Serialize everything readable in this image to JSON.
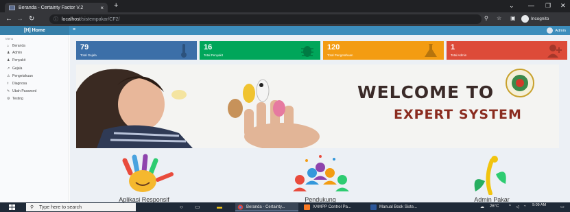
{
  "browser": {
    "tab_title": "Beranda - Certainty Factor V.2",
    "tab_close": "×",
    "new_tab": "+",
    "url_host": "localhost",
    "url_path": "/sistempakar/CF2/",
    "profile_label": "Incognito"
  },
  "app": {
    "brand": "[H] Home",
    "user_label": "Admin"
  },
  "sidebar": {
    "heading": "Menu",
    "items": [
      {
        "icon": "home-icon",
        "glyph": "⌂",
        "label": "Beranda"
      },
      {
        "icon": "user-icon",
        "glyph": "♟",
        "label": "Admin"
      },
      {
        "icon": "disease-icon",
        "glyph": "♟",
        "label": "Penyakit"
      },
      {
        "icon": "symptom-icon",
        "glyph": "↗",
        "label": "Gejala"
      },
      {
        "icon": "knowledge-icon",
        "glyph": "⚠",
        "label": "Pengetahuan"
      },
      {
        "icon": "diagnosis-icon",
        "glyph": "⚕",
        "label": "Diagnosa"
      },
      {
        "icon": "password-icon",
        "glyph": "✎",
        "label": "Ubah Password"
      },
      {
        "icon": "testing-icon",
        "glyph": "⚙",
        "label": "Testing"
      }
    ]
  },
  "stats": [
    {
      "value": "79",
      "label": "Total Gejala",
      "color": "#3c6fa8",
      "icon": "thermometer-icon"
    },
    {
      "value": "16",
      "label": "Total Penyakit",
      "color": "#00a65a",
      "icon": "bug-icon"
    },
    {
      "value": "120",
      "label": "Total Pengetahuan",
      "color": "#f39c12",
      "icon": "flask-icon"
    },
    {
      "value": "1",
      "label": "Total Admin",
      "color": "#dd4b39",
      "icon": "user-plus-icon"
    }
  ],
  "banner": {
    "line1": "WELCOME TO",
    "line2": "EXPERT SYSTEM"
  },
  "features": [
    {
      "label": "Aplikasi Responsif",
      "icon": "hand-smile-icon"
    },
    {
      "label": "Pendukung",
      "icon": "people-group-icon"
    },
    {
      "label": "Admin Pakar",
      "icon": "plant-person-icon"
    }
  ],
  "taskbar": {
    "search_placeholder": "Type here to search",
    "apps": [
      {
        "label": "Beranda - Certainty...",
        "color": "#db4437"
      },
      {
        "label": "XAMPP Control Pa...",
        "color": "#fb7a24"
      },
      {
        "label": "Manual Book Siste...",
        "color": "#2b579a"
      }
    ],
    "temperature": "26°C",
    "time": "9:09 AM"
  }
}
